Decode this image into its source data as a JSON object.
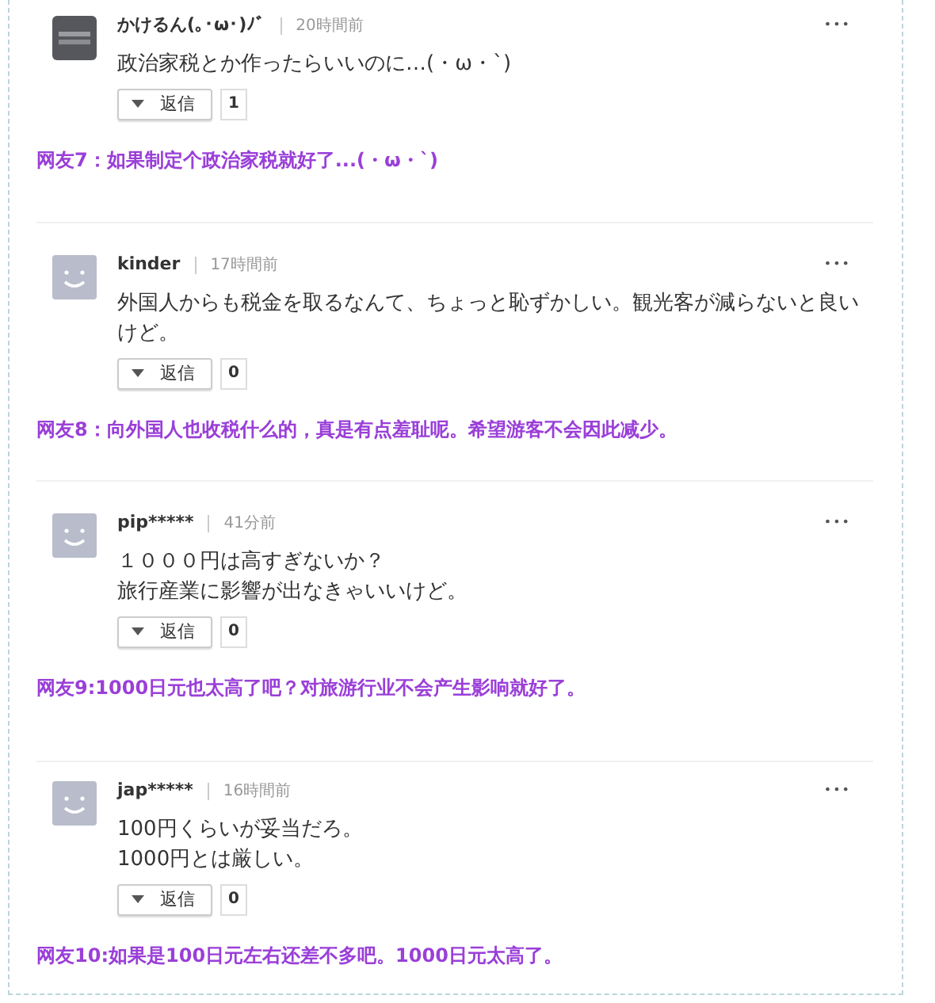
{
  "comments": [
    {
      "kind": "dark",
      "username": "かけるん(｡･ω･)ﾉﾞ",
      "time": "20時間前",
      "menu": "•••",
      "body": [
        "政治家税とか作ったらいいのに…(・ω・`)"
      ],
      "reply_label": "返信",
      "reply_count": "1",
      "translation": "网友7：如果制定个政治家税就好了...(・ω・`)"
    },
    {
      "kind": "smiley",
      "username": "kinder",
      "time": "17時間前",
      "menu": "•••",
      "body": [
        "外国人からも税金を取るなんて、ちょっと恥ずかしい。観光客が減らないと良いけど。"
      ],
      "reply_label": "返信",
      "reply_count": "0",
      "translation": "网友8：向外国人也收税什么的，真是有点羞耻呢。希望游客不会因此减少。"
    },
    {
      "kind": "smiley",
      "username": "pip*****",
      "time": "41分前",
      "menu": "•••",
      "body": [
        "１０００円は高すぎないか？",
        "旅行産業に影響が出なきゃいいけど。"
      ],
      "reply_label": "返信",
      "reply_count": "0",
      "translation": "网友9:1000日元也太高了吧？对旅游行业不会产生影响就好了。"
    },
    {
      "kind": "smiley",
      "username": "jap*****",
      "time": "16時間前",
      "menu": "•••",
      "body": [
        "100円くらいが妥当だろ。",
        "1000円とは厳しい。"
      ],
      "reply_label": "返信",
      "reply_count": "0",
      "translation": "网友10:如果是100日元左右还差不多吧。1000日元太高了。"
    }
  ]
}
